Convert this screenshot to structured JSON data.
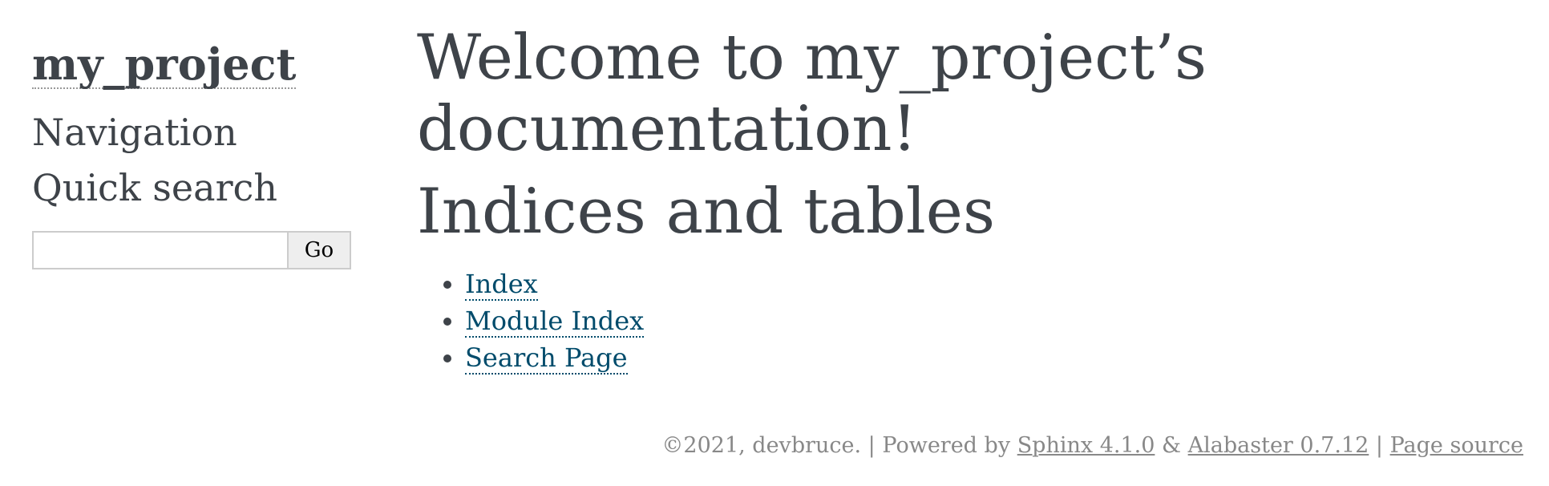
{
  "sidebar": {
    "project_name": "my_project",
    "navigation_heading": "Navigation",
    "quick_search_heading": "Quick search",
    "search": {
      "value": "",
      "placeholder": "",
      "button_label": "Go"
    }
  },
  "main": {
    "title": "Welcome to my_project’s documentation!",
    "section_title": "Indices and tables",
    "links": [
      {
        "label": "Index"
      },
      {
        "label": "Module Index"
      },
      {
        "label": "Search Page"
      }
    ]
  },
  "footer": {
    "copyright": "©2021, devbruce.",
    "sep1": "|",
    "powered_by": "Powered by",
    "sphinx_link": "Sphinx 4.1.0",
    "amp": "&",
    "alabaster_link": "Alabaster 0.7.12",
    "sep2": "|",
    "page_source_link": "Page source"
  },
  "colors": {
    "text": "#3e4349",
    "link": "#004b6b",
    "footer_text": "#888888",
    "button_bg": "#eeeeee",
    "input_border": "#cccccc"
  }
}
